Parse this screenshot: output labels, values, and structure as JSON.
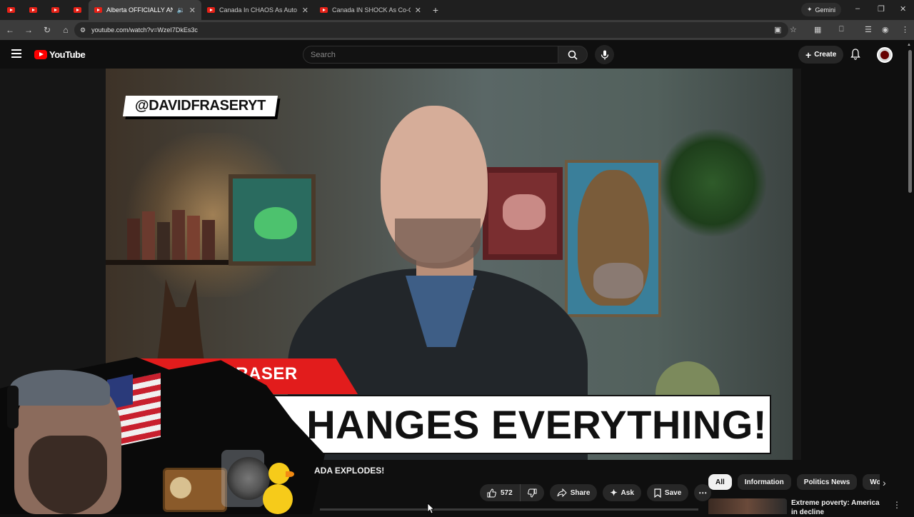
{
  "browser": {
    "pinned_tabs": [
      "",
      "",
      "",
      ""
    ],
    "tabs": [
      {
        "title": "Alberta OFFICIALLY ANNOU",
        "active": true
      },
      {
        "title": "Canada In CHAOS As Auto Ma",
        "active": false
      },
      {
        "title": "Canada IN SHOCK As Co-Op Cl",
        "active": false
      }
    ],
    "gemini_label": "Gemini",
    "url": "youtube.com/watch?v=WzeI7DkEs3c"
  },
  "youtube": {
    "logo_text": "YouTube",
    "search_placeholder": "Search",
    "create_label": "Create"
  },
  "video": {
    "handle_overlay": "@DAVIDFRASERYT",
    "red_band_text": "FRASER",
    "headline_text": "HANGES EVERYTHING!",
    "title_visible": "ADA EXPLODES!",
    "like_count": "572",
    "share_label": "Share",
    "ask_label": "Ask",
    "save_label": "Save"
  },
  "sidebar": {
    "chips": [
      "All",
      "Information",
      "Politics News",
      "World New"
    ],
    "active_chip": "All",
    "recommendation_title": "Extreme poverty: America in decline"
  },
  "colors": {
    "youtube_red": "#ff0000",
    "page_bg": "#0f0f0f",
    "band_red": "#e21c1c"
  }
}
